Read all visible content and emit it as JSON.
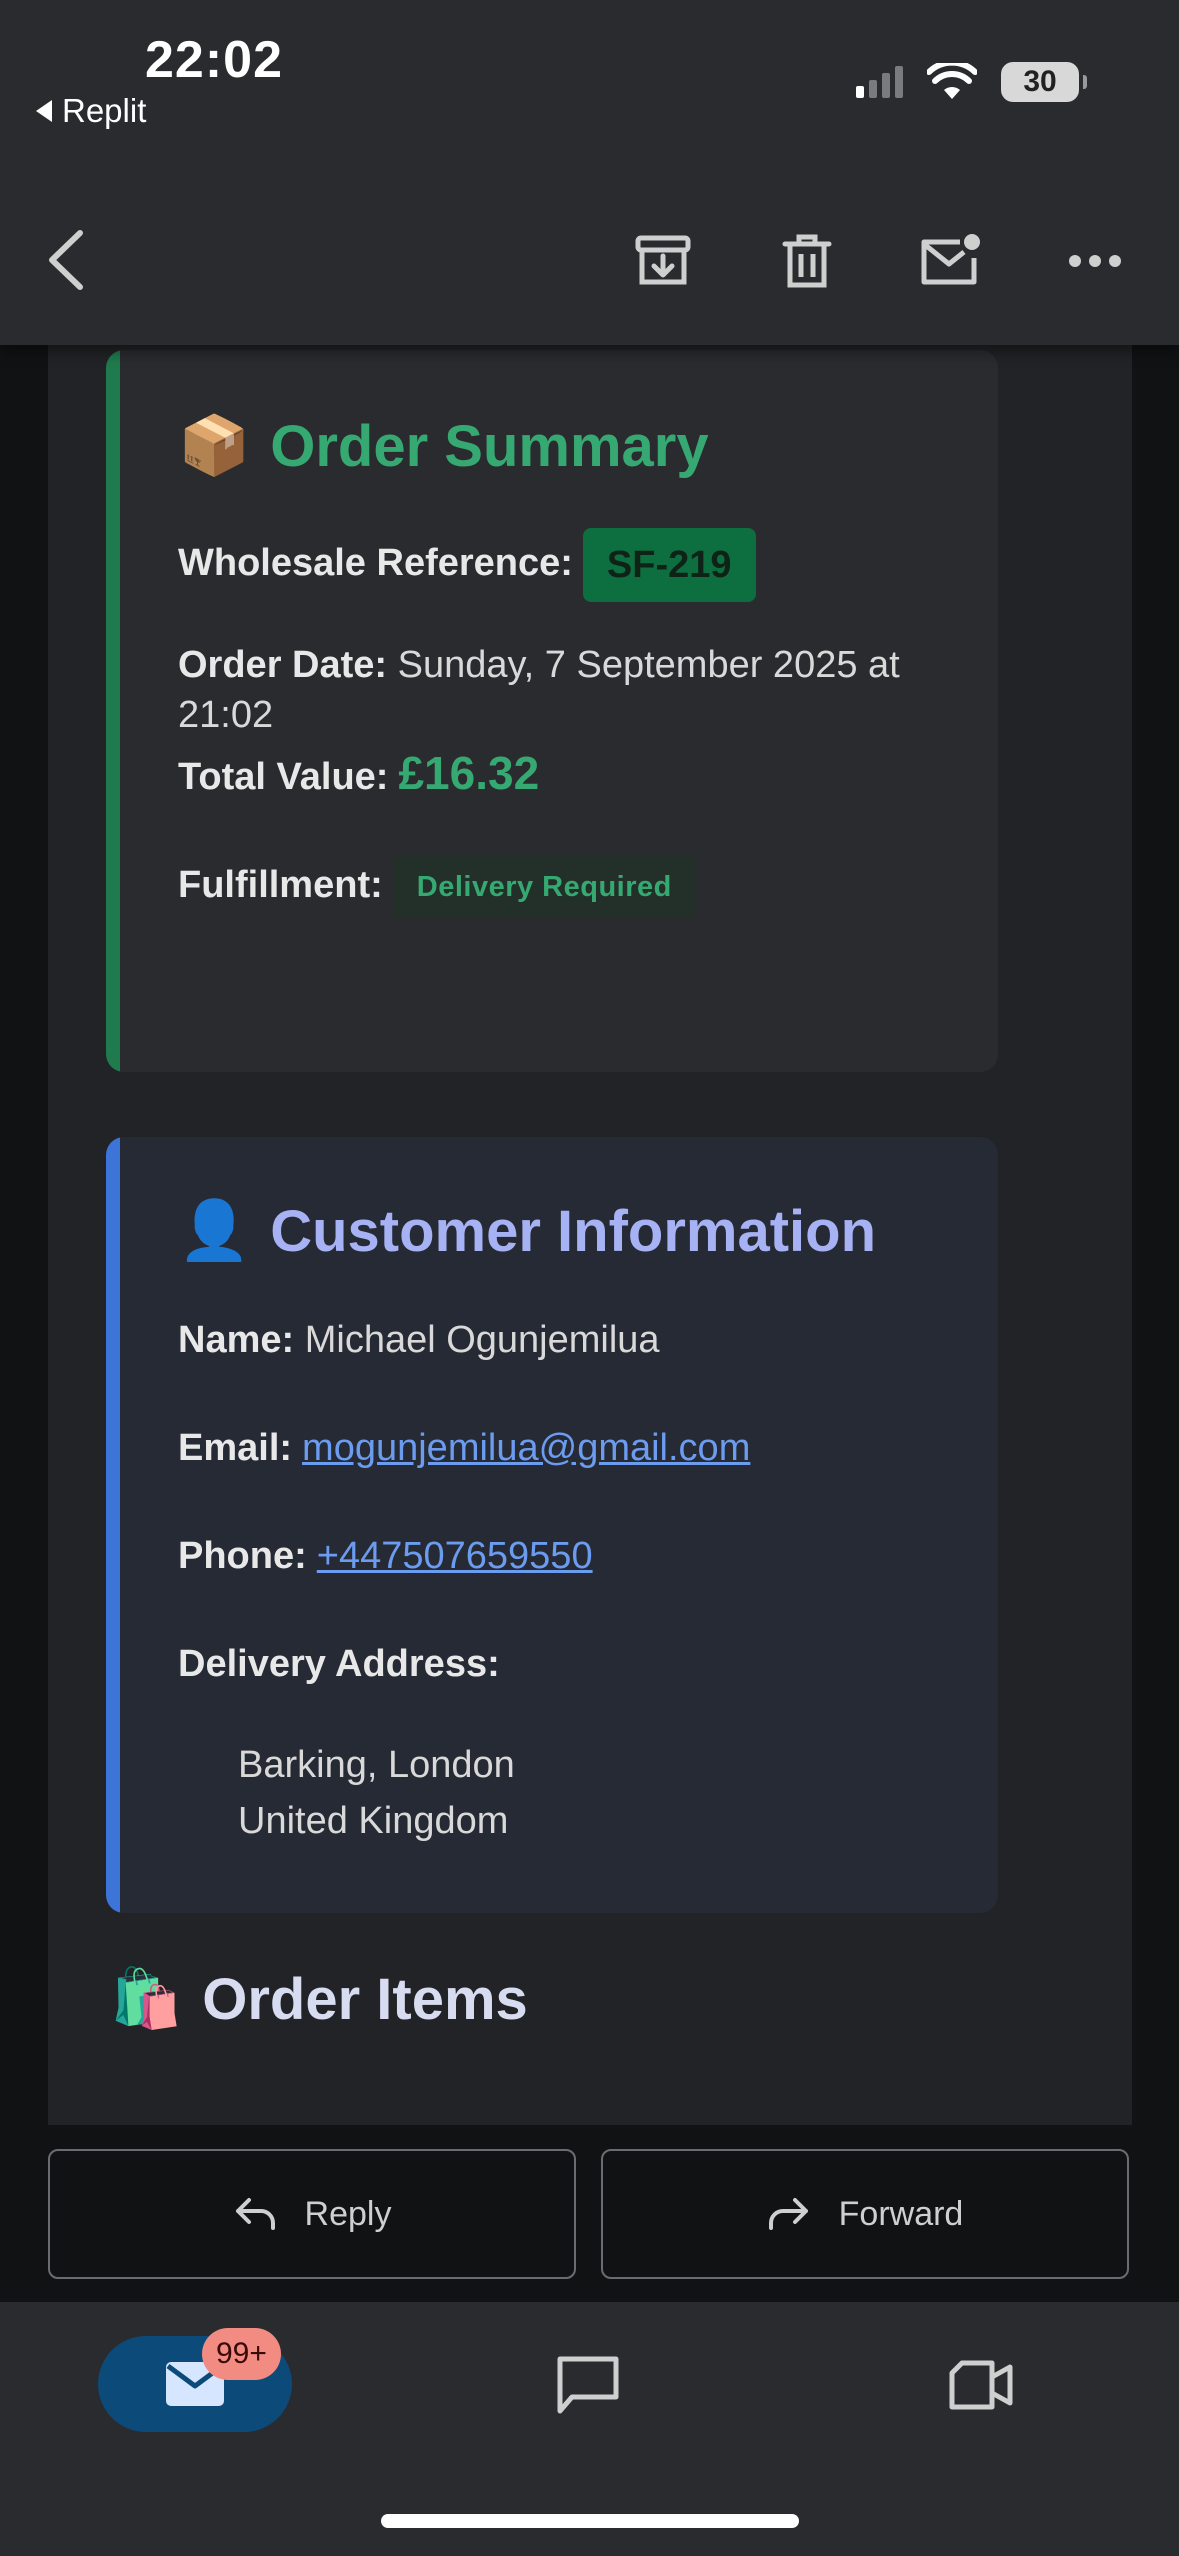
{
  "status_bar": {
    "time": "22:02",
    "back_app": "Replit",
    "battery": "30"
  },
  "toolbar": {
    "icons": [
      "back-icon",
      "archive-icon",
      "trash-icon",
      "mark-unread-icon",
      "more-icon"
    ]
  },
  "order_summary": {
    "emoji": "📦",
    "title": "Order Summary",
    "ref_label": "Wholesale Reference:",
    "ref_value": "SF-219",
    "date_label": "Order Date:",
    "date_value_line1": "Sunday, 7 September 2025 at",
    "date_value_line2": "21:02",
    "total_label": "Total Value:",
    "total_value": "£16.32",
    "fulfillment_label": "Fulfillment:",
    "fulfillment_value": "Delivery Required"
  },
  "customer": {
    "emoji": "👤",
    "title": "Customer Information",
    "name_label": "Name:",
    "name_value": "Michael Ogunjemilua",
    "email_label": "Email:",
    "email_value": "mogunjemilua@gmail.com",
    "phone_label": "Phone:",
    "phone_value": "+447507659550",
    "address_label": "Delivery Address:",
    "address_line1": "Barking, London",
    "address_line2": "United Kingdom"
  },
  "order_items": {
    "emoji": "🛍️",
    "title": "Order Items"
  },
  "actions": {
    "reply": "Reply",
    "forward": "Forward"
  },
  "bottom_nav": {
    "mail_badge": "99+",
    "icons": [
      "mail-icon",
      "chat-icon",
      "meet-icon"
    ]
  },
  "colors": {
    "accent_green": "#36a972",
    "accent_blue": "#3d74d8",
    "title_purple": "#a7b2f5",
    "link_blue": "#6b9cf0",
    "badge_red": "#f28b82"
  }
}
